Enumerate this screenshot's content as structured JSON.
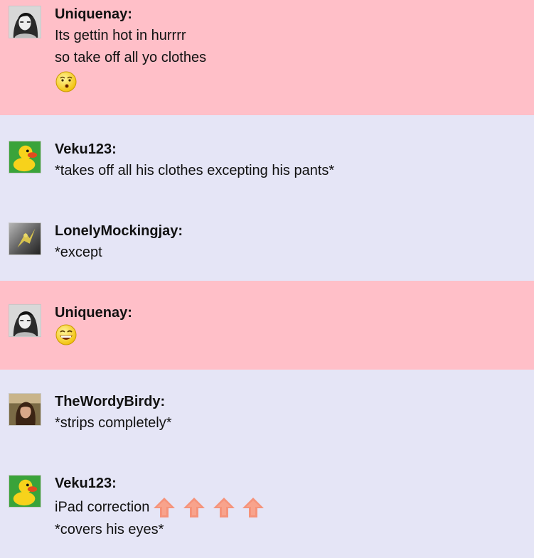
{
  "messages": [
    {
      "user": "Uniquenay:",
      "avatar": "uniquenay-avatar",
      "lines": [
        "Its gettin hot in hurrrr",
        "so take off all yo clothes"
      ],
      "emoji": "whistling-face-icon",
      "bg": "#ffbfc8"
    },
    {
      "user": "Veku123:",
      "avatar": "duck-avatar",
      "lines": [
        "*takes off all his clothes excepting his pants*"
      ],
      "bg": "#e5e5f6"
    },
    {
      "user": "LonelyMockingjay:",
      "avatar": "mockingjay-avatar",
      "lines": [
        "*except"
      ],
      "bg": "#e5e5f6"
    },
    {
      "user": "Uniquenay:",
      "avatar": "uniquenay-avatar",
      "lines": [],
      "emoji": "grinning-face-icon",
      "bg": "#ffbfc8"
    },
    {
      "user": "TheWordyBirdy:",
      "avatar": "wordybirdy-avatar",
      "lines": [
        "*strips completely*"
      ],
      "bg": "#e5e5f6"
    },
    {
      "user": "Veku123:",
      "avatar": "duck-avatar",
      "lines": [
        "iPad correction",
        "*covers his eyes*"
      ],
      "arrows": [
        "up-arrow-icon",
        "up-arrow-icon",
        "up-arrow-icon",
        "up-arrow-icon"
      ],
      "bg": "#e5e5f6"
    }
  ],
  "colors": {
    "pink": "#ffbfc8",
    "lavender": "#e5e5f6",
    "arrow": "#f5937a"
  }
}
